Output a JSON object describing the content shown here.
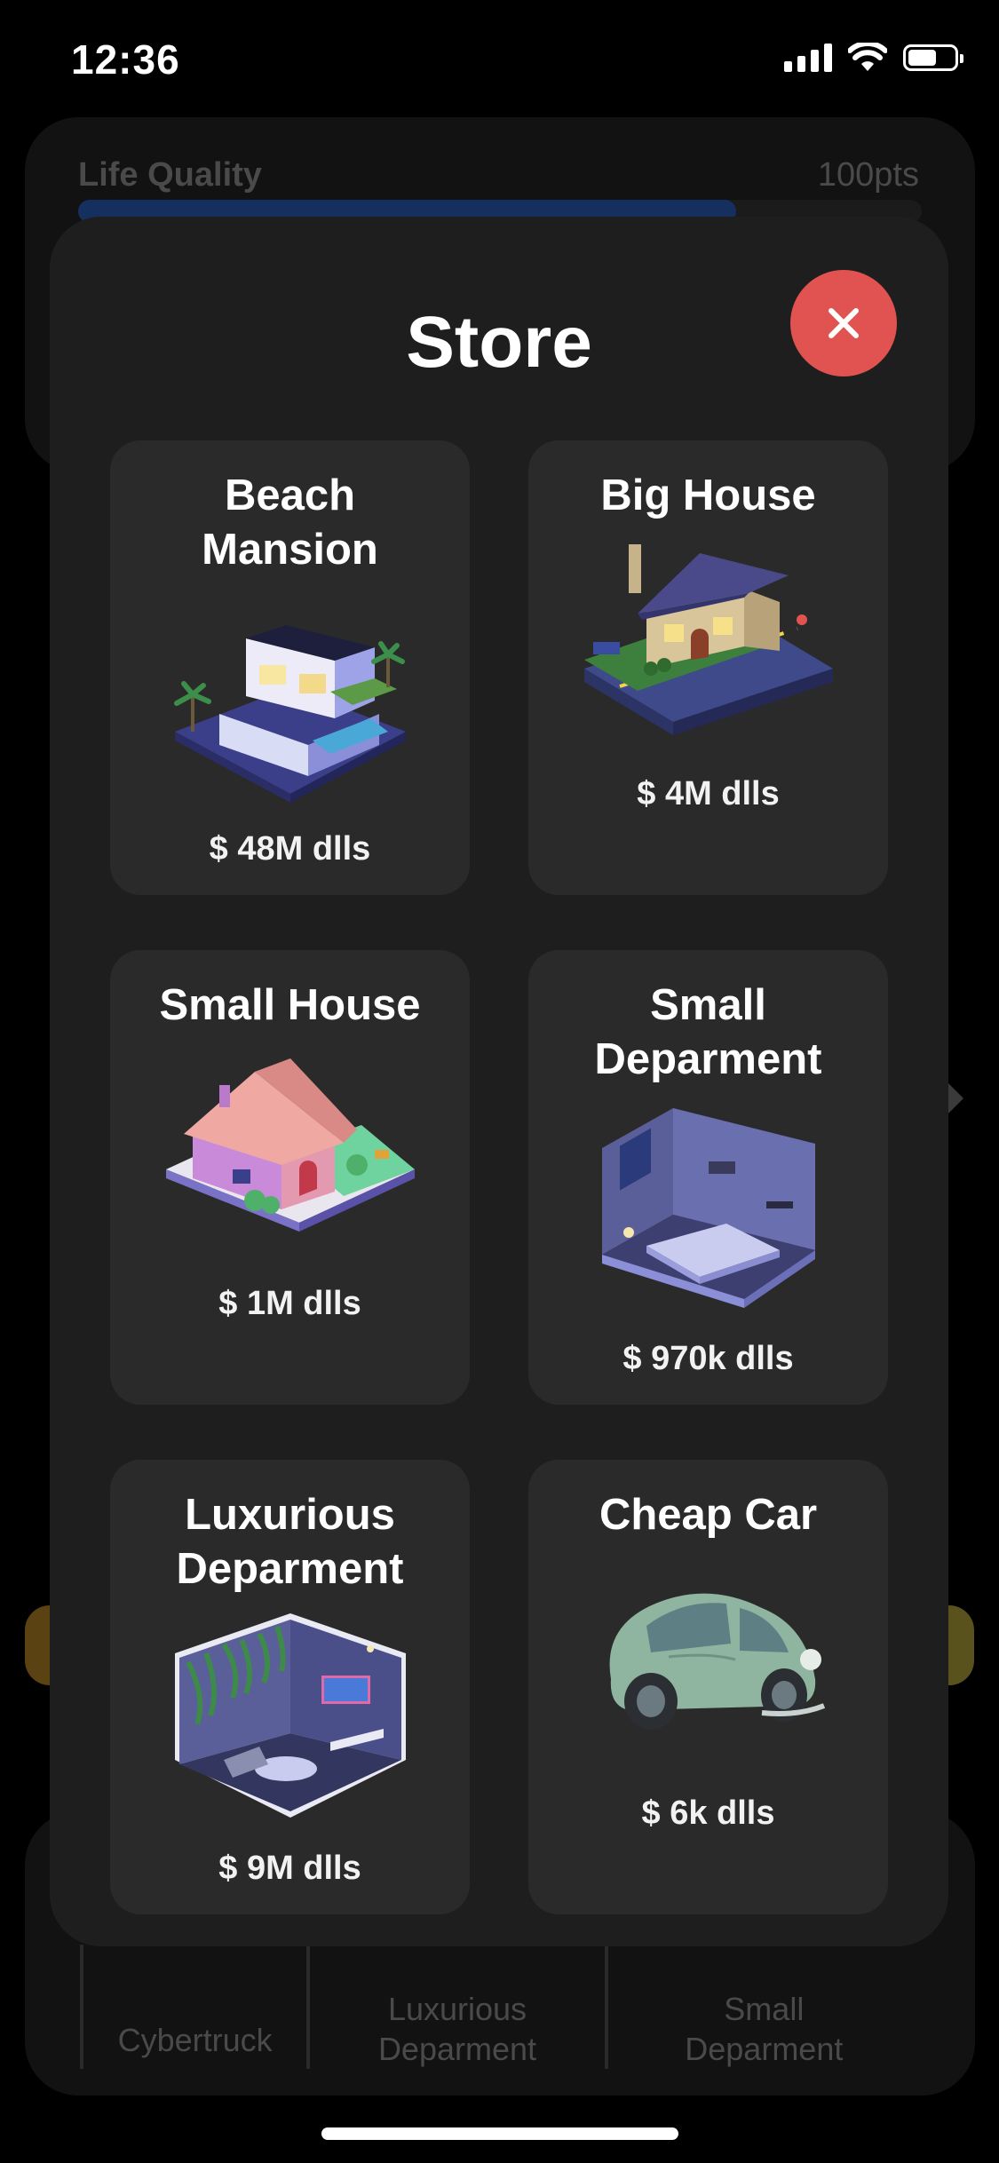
{
  "status": {
    "time": "12:36"
  },
  "background": {
    "life_quality_label": "Life Quality",
    "life_quality_points": "100pts",
    "life_quality_progress_percent": 78,
    "bottom_items": [
      "Cybertruck",
      "Luxurious Deparment",
      "Small Deparment"
    ]
  },
  "store": {
    "title": "Store",
    "close_icon": "close-icon",
    "items": [
      {
        "name": "Beach Mansion",
        "price": "$ 48M dlls",
        "icon": "beach-mansion-icon"
      },
      {
        "name": "Big House",
        "price": "$ 4M dlls",
        "icon": "big-house-icon"
      },
      {
        "name": "Small House",
        "price": "$ 1M dlls",
        "icon": "small-house-icon"
      },
      {
        "name": "Small Deparment",
        "price": "$ 970k dlls",
        "icon": "small-department-icon"
      },
      {
        "name": "Luxurious Deparment",
        "price": "$ 9M dlls",
        "icon": "luxurious-department-icon"
      },
      {
        "name": "Cheap Car",
        "price": "$ 6k dlls",
        "icon": "cheap-car-icon"
      }
    ]
  },
  "colors": {
    "close_button": "#e05350",
    "modal_bg": "#1e1e1e",
    "card_bg": "#2a2a2a",
    "progress_fill": "#15305f"
  }
}
